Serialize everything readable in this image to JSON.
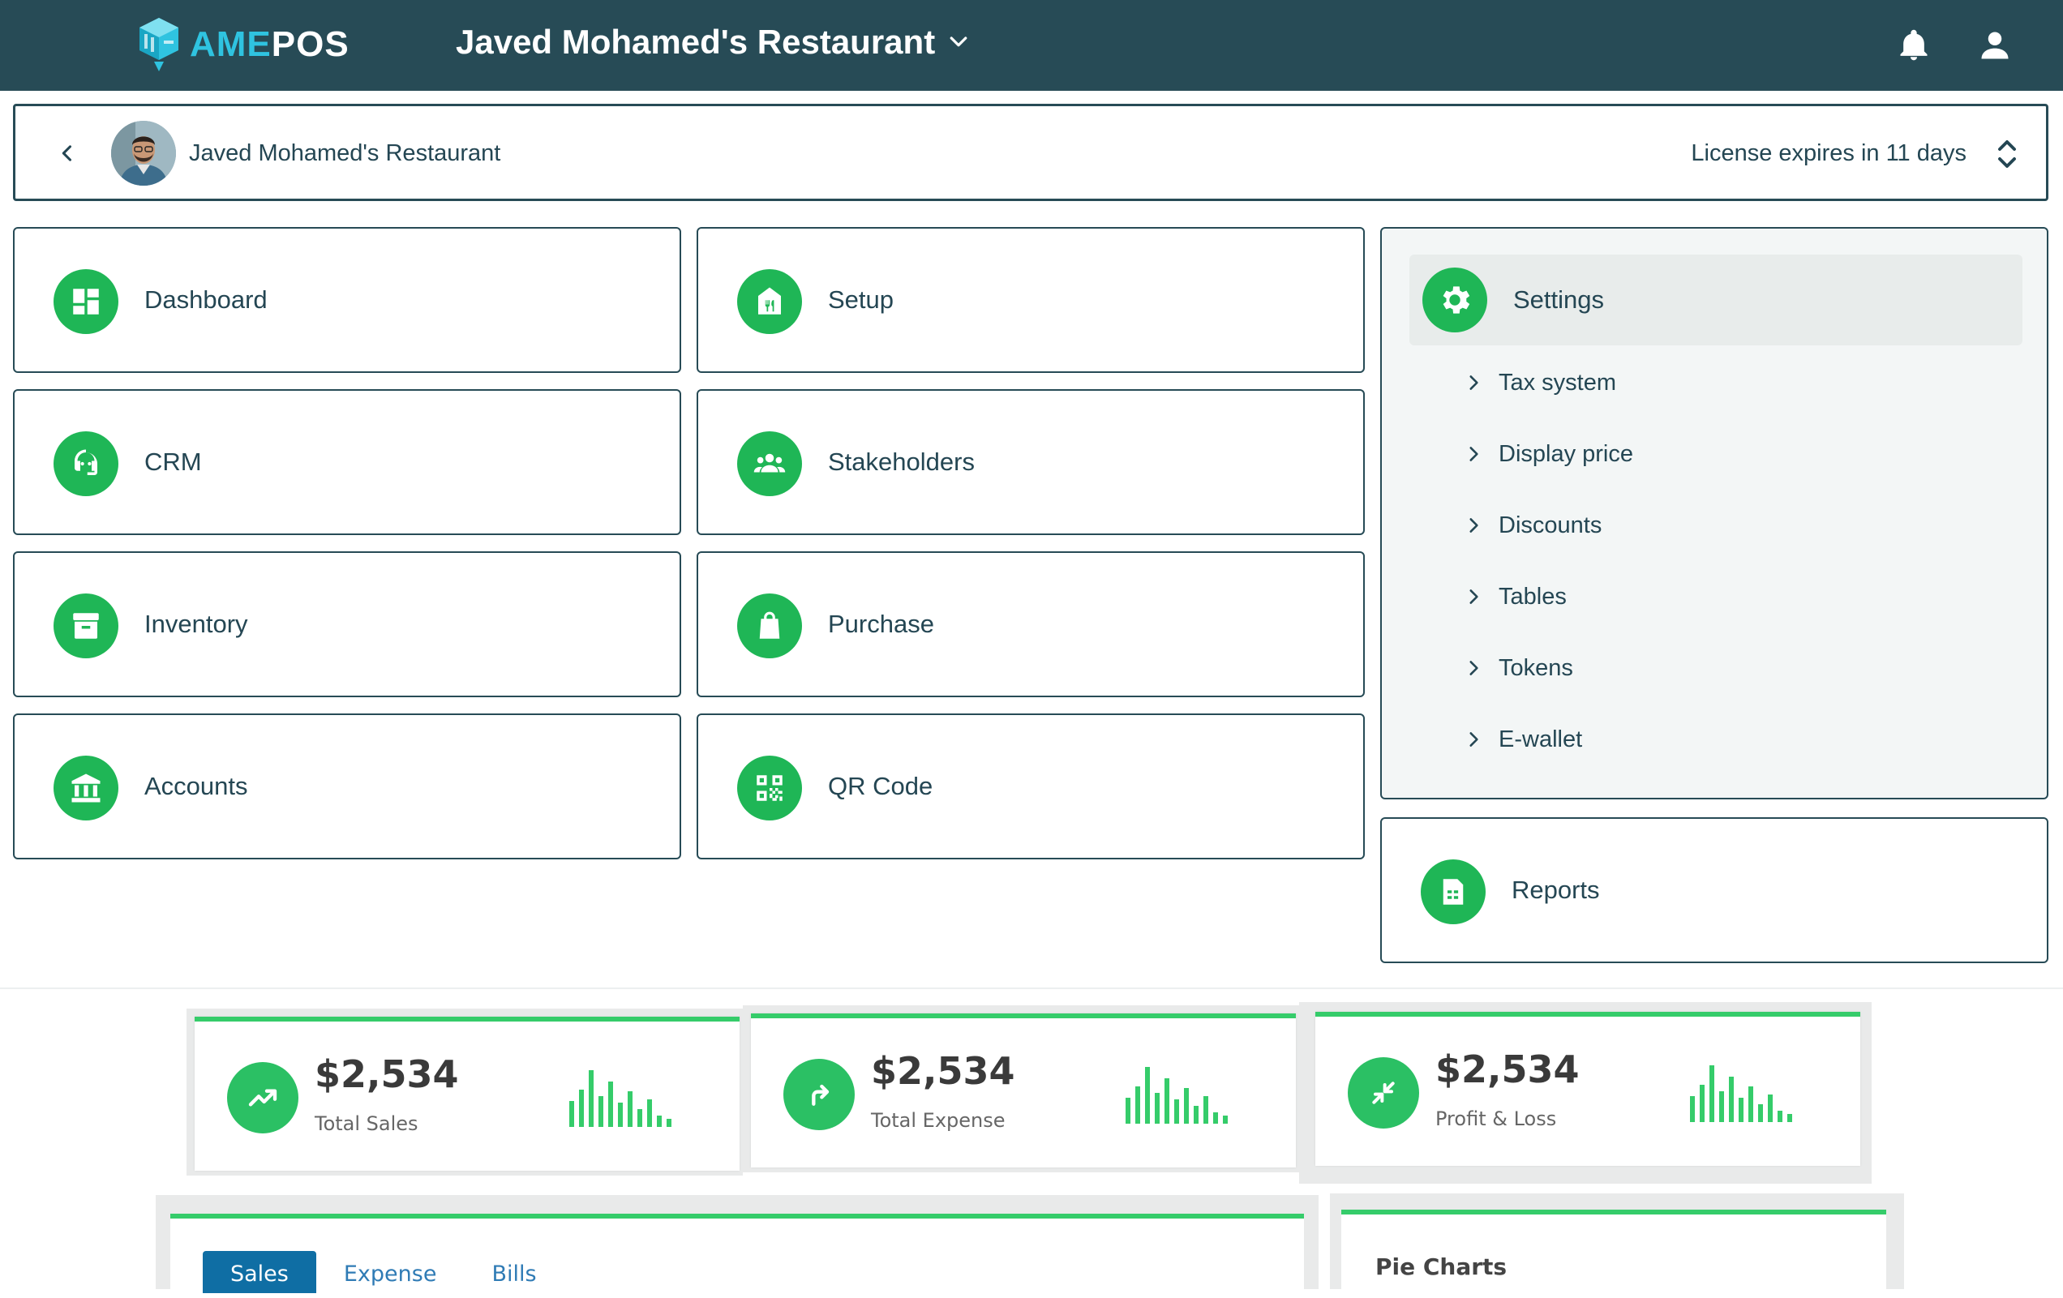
{
  "app": {
    "logo_part1": "AME",
    "logo_part2": "POS",
    "restaurant_selector": "Javed Mohamed's Restaurant",
    "icons": {
      "notifications": "bell-icon",
      "account": "user-icon",
      "selector": "chevron-down-icon"
    }
  },
  "account_bar": {
    "name": "Javed Mohamed's Restaurant",
    "license": "License expires in 11 days"
  },
  "modules": [
    {
      "label": "Dashboard",
      "icon": "dashboard-icon"
    },
    {
      "label": "Setup",
      "icon": "store-icon"
    },
    {
      "label": "CRM",
      "icon": "support-agent-icon"
    },
    {
      "label": "Stakeholders",
      "icon": "group-icon"
    },
    {
      "label": "Inventory",
      "icon": "archive-icon"
    },
    {
      "label": "Purchase",
      "icon": "shopping-bag-icon"
    },
    {
      "label": "Accounts",
      "icon": "bank-icon"
    },
    {
      "label": "QR Code",
      "icon": "qr-code-icon"
    }
  ],
  "settings": {
    "label": "Settings",
    "items": [
      "Tax system",
      "Display price",
      "Discounts",
      "Tables",
      "Tokens",
      "E-wallet"
    ]
  },
  "reports": {
    "label": "Reports"
  },
  "preview": {
    "stats": [
      {
        "amount": "$2,534",
        "caption": "Total Sales"
      },
      {
        "amount": "$2,534",
        "caption": "Total Expense"
      },
      {
        "amount": "$2,534",
        "caption": "Profit & Loss"
      }
    ],
    "tabs": [
      "Sales",
      "Expense",
      "Bills"
    ],
    "pie_title": "Pie Charts"
  },
  "colors": {
    "topbar": "#274b56",
    "accent_green": "#1fb656",
    "logo_cyan": "#2fc3e0",
    "tab_active": "#0f6ea4"
  }
}
